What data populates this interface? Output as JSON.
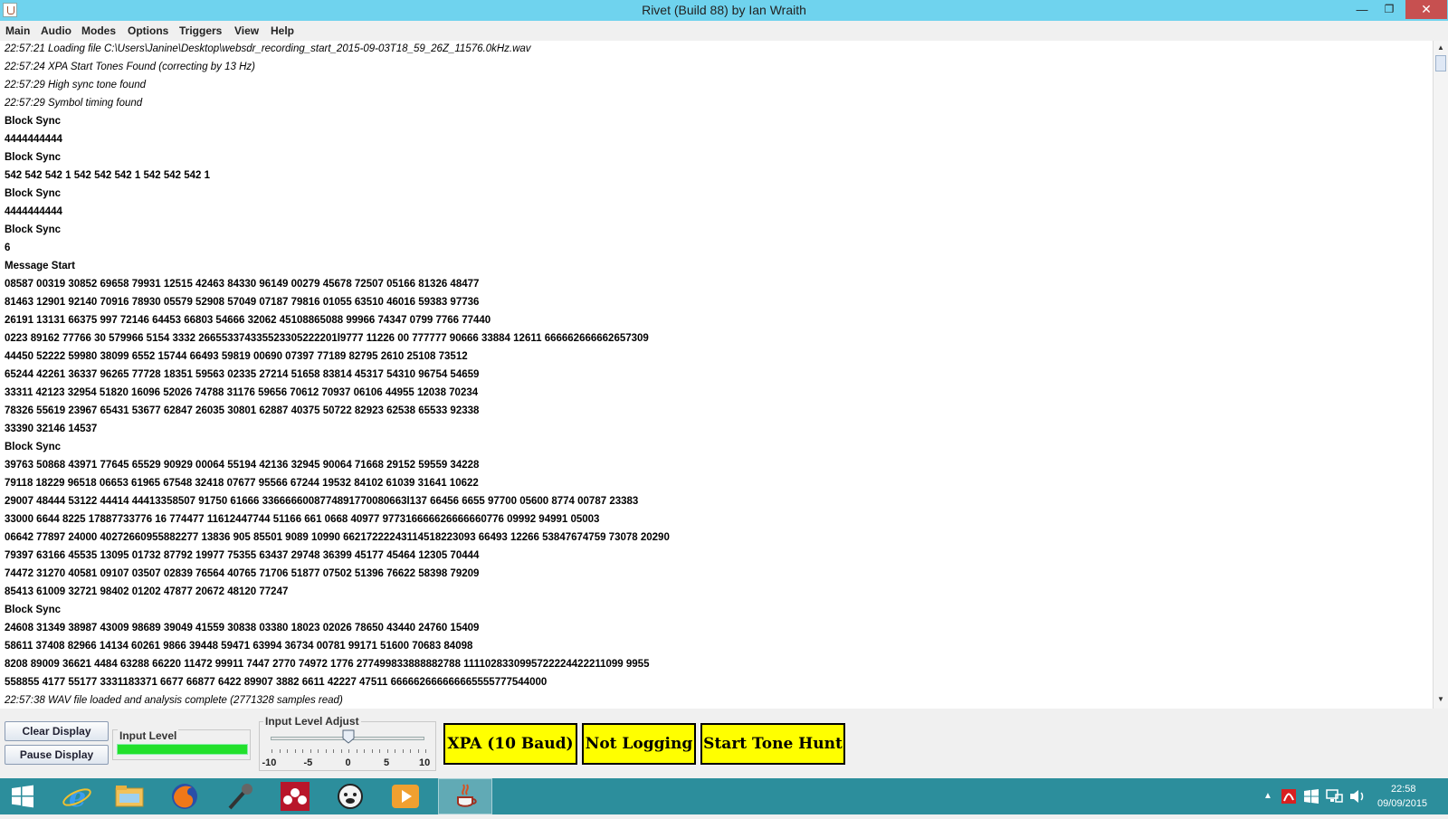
{
  "window": {
    "title": "Rivet (Build 88) by Ian Wraith"
  },
  "menu": [
    "Main",
    "Audio",
    "Modes",
    "Options",
    "Triggers",
    "View",
    "Help"
  ],
  "log_lines": [
    {
      "t": "22:57:21 Loading file C:\\Users\\Janine\\Desktop\\websdr_recording_start_2015-09-03T18_59_26Z_11576.0kHz.wav",
      "s": "i"
    },
    {
      "t": "22:57:24 XPA Start Tones Found (correcting by 13 Hz)",
      "s": "i"
    },
    {
      "t": "22:57:29 High sync tone found",
      "s": "i"
    },
    {
      "t": "22:57:29 Symbol timing found",
      "s": "i"
    },
    {
      "t": "Block Sync",
      "s": "b"
    },
    {
      "t": "4444444444",
      "s": "b"
    },
    {
      "t": "Block Sync",
      "s": "b"
    },
    {
      "t": "542 542 542 1 542 542 542 1 542 542 542 1",
      "s": "b"
    },
    {
      "t": "Block Sync",
      "s": "b"
    },
    {
      "t": "4444444444",
      "s": "b"
    },
    {
      "t": "Block Sync",
      "s": "b"
    },
    {
      "t": "6",
      "s": "b"
    },
    {
      "t": "Message Start",
      "s": "b"
    },
    {
      "t": "08587 00319 30852 69658 79931 12515 42463 84330 96149 00279 45678 72507 05166 81326 48477",
      "s": "b"
    },
    {
      "t": "81463 12901 92140 70916 78930 05579 52908 57049 07187 79816 01055 63510 46016 59383 97736",
      "s": "b"
    },
    {
      "t": "26191 13131 66375 997 72146 64453 66803 54666 32062 45108865088 99966 74347 0799 7766 77440",
      "s": "b"
    },
    {
      "t": "0223 89162 77766 30 579966 5154 3332 266553374335523305222201l9777 11226 00 777777 90666 33884 12611 666662666662657309",
      "s": "b"
    },
    {
      "t": "44450 52222 59980 38099 6552 15744 66493 59819 00690 07397 77189 82795 2610 25108 73512",
      "s": "b"
    },
    {
      "t": "65244 42261 36337 96265 77728 18351 59563 02335 27214 51658 83814 45317 54310 96754 54659",
      "s": "b"
    },
    {
      "t": "33311 42123 32954 51820 16096 52026 74788 31176 59656 70612 70937 06106 44955 12038 70234",
      "s": "b"
    },
    {
      "t": "78326 55619 23967 65431 53677 62847 26035 30801 62887 40375 50722 82923 62538 65533 92338",
      "s": "b"
    },
    {
      "t": "33390 32146 14537",
      "s": "b"
    },
    {
      "t": "Block Sync",
      "s": "b"
    },
    {
      "t": "39763 50868 43971 77645 65529 90929 00064 55194 42136 32945 90064 71668 29152 59559 34228",
      "s": "b"
    },
    {
      "t": "79118 18229 96518 06653 61965 67548 32418 07677 95566 67244 19532 84102 61039 31641 10622",
      "s": "b"
    },
    {
      "t": "29007 48444 53122 44414 44413358507 91750 61666 3366666008774891770080663l137 66456 6655 97700 05600 8774 00787 23383",
      "s": "b"
    },
    {
      "t": "33000 6644 8225 17887733776 16 774477 11612447744 51166 661 0668 40977 977316666626666660776 09992 94991 05003",
      "s": "b"
    },
    {
      "t": "06642 77897 24000 40272660955882277 13836 905 85501 9089 10990 66217222243114518223093 66493 12266 53847674759 73078 20290",
      "s": "b"
    },
    {
      "t": "79397 63166 45535 13095 01732 87792 19977 75355 63437 29748 36399 45177 45464 12305 70444",
      "s": "b"
    },
    {
      "t": "74472 31270 40581 09107 03507 02839 76564 40765 71706 51877 07502 51396 76622 58398 79209",
      "s": "b"
    },
    {
      "t": "85413 61009 32721 98402 01202 47877 20672 48120 77247",
      "s": "b"
    },
    {
      "t": "Block Sync",
      "s": "b"
    },
    {
      "t": "24608 31349 38987 43009 98689 39049 41559 30838 03380 18023 02026 78650 43440 24760 15409",
      "s": "b"
    },
    {
      "t": "58611 37408 82966 14134 60261 9866 39448 59471 63994 36734 00781 99171 51600 70683 84098",
      "s": "b"
    },
    {
      "t": "8208 89009 36621 4484 63288 66220 11472 99911 7447 2770 74972 1776 277499833888882788 1111028330995722224422211099 9955",
      "s": "b"
    },
    {
      "t": "558855 4177 55177 3331183371 6677 66877 6422 89907 3882 6611 42227 47511 666662666666665555777544000",
      "s": "b"
    },
    {
      "t": "22:57:38 WAV file loaded and analysis complete (2771328 samples read)",
      "s": "i"
    }
  ],
  "controls": {
    "clear_display": "Clear Display",
    "pause_display": "Pause Display",
    "input_level_label": "Input Level",
    "input_level_value": 1.0,
    "input_adjust_label": "Input Level Adjust",
    "slider_value": 0,
    "slider_min": -10,
    "slider_max": 10,
    "slider_ticks": [
      "-10",
      "-5",
      "0",
      "5",
      "10"
    ],
    "mode_button": "XPA (10 Baud)",
    "logging_button": "Not Logging",
    "tone_hunt_button": "Start Tone Hunt"
  },
  "taskbar": {
    "clock_time": "22:58",
    "clock_date": "09/09/2015"
  }
}
